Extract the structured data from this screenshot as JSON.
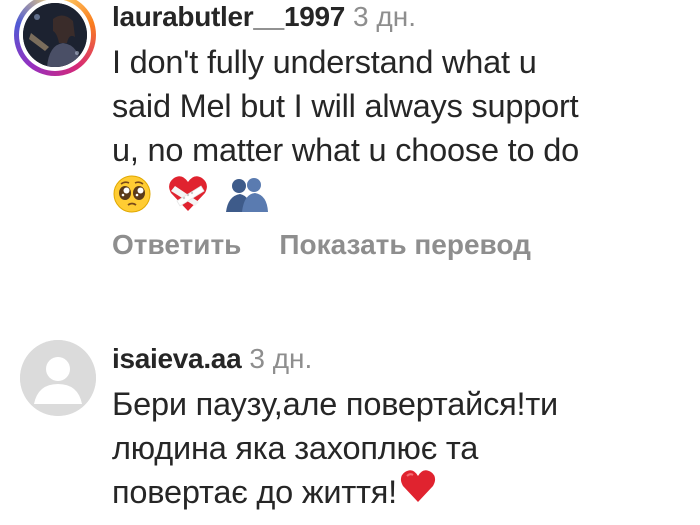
{
  "comments": [
    {
      "username": "laurabutler__1997",
      "time": "3 дн.",
      "lines": [
        "I don't fully understand what u",
        "said Mel but I will always support",
        "u, no matter what u choose to do"
      ],
      "emoji_icons": [
        "pleading-face-emoji-icon",
        "bandaged-heart-emoji-icon",
        "hugging-people-emoji-icon"
      ],
      "reply_label": "Ответить",
      "translate_label": "Показать перевод"
    },
    {
      "username": "isaieva.aa",
      "time": "3 дн.",
      "lines": [
        "Бери паузу,але повертайся!ти",
        "людина яка захоплює та",
        "повертає до життя!"
      ],
      "emoji_icons": [
        "red-heart-emoji-icon"
      ]
    }
  ],
  "colors": {
    "text": "#262626",
    "muted": "#8e8e8e",
    "heart": "#e0232f",
    "avatar_placeholder": "#dbdbdb"
  }
}
